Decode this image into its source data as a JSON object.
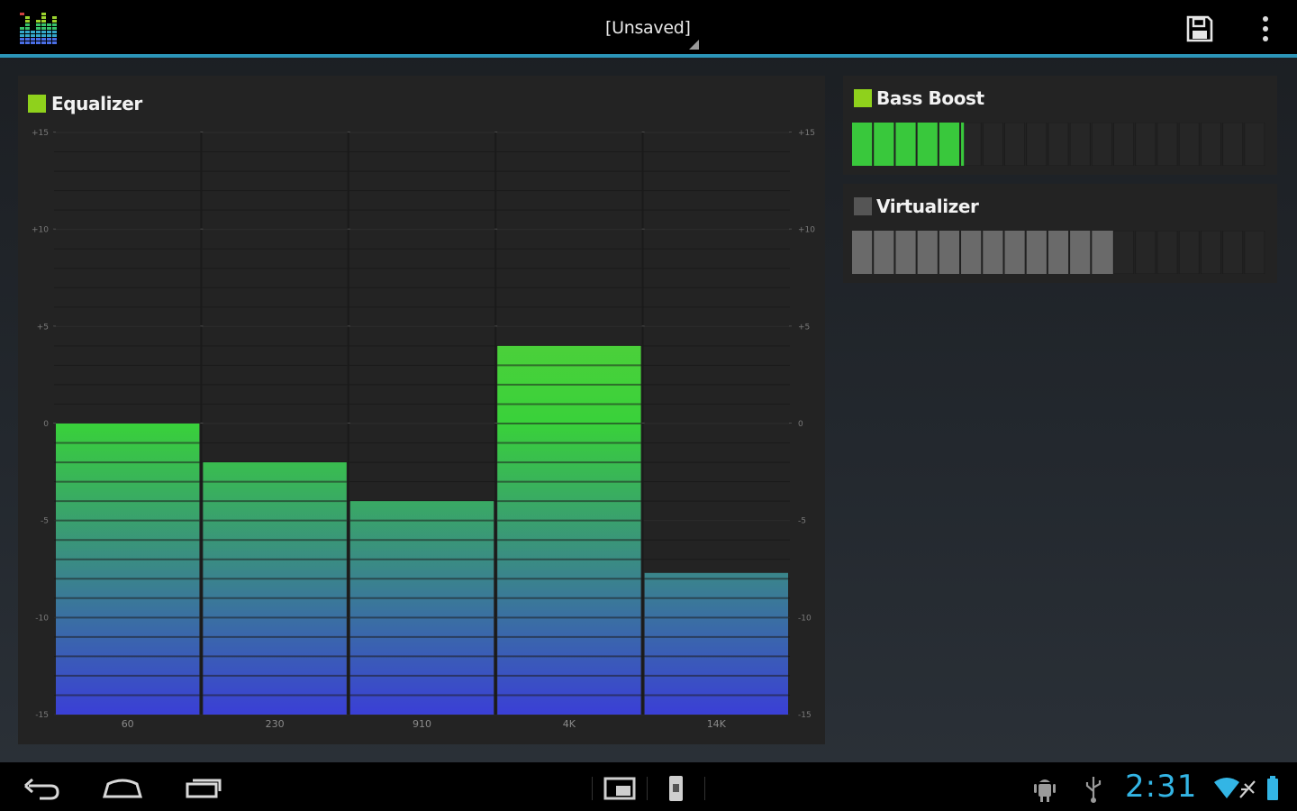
{
  "action_bar": {
    "title": "[Unsaved]",
    "app_icon": "equalizer-app-icon",
    "save_icon": "save-icon",
    "overflow_icon": "overflow-menu-icon",
    "accent_color": "#2c95b8"
  },
  "equalizer": {
    "label": "Equalizer",
    "enabled": true,
    "check_color": "#8fd11c",
    "chart_data": {
      "type": "bar",
      "categories": [
        "60",
        "230",
        "910",
        "4K",
        "14K"
      ],
      "values": [
        0,
        -2,
        -4,
        4,
        -7.7
      ],
      "ylim": [
        -15,
        15
      ],
      "y_ticks_left": [
        "+15",
        "+10",
        "+5",
        "0",
        "-5",
        "-10",
        "-15"
      ],
      "y_ticks_right": [
        "+15",
        "+10",
        "+5",
        "0",
        "-5",
        "-10",
        "-15"
      ],
      "grid": true,
      "gradient": [
        "#39d13a",
        "#3a3fd6"
      ]
    }
  },
  "bass_boost": {
    "label": "Bass Boost",
    "enabled": true,
    "check_color": "#8fd11c",
    "level": 0.27,
    "fill_color": "#39c83c"
  },
  "virtualizer": {
    "label": "Virtualizer",
    "enabled": false,
    "check_color": "#555555",
    "level": 0.63,
    "fill_color": "#6a6a6a"
  },
  "nav_bar": {
    "back_icon": "back-icon",
    "home_icon": "home-icon",
    "recents_icon": "recent-apps-icon",
    "screenshot_icon": "screenshot-icon",
    "notification_icon": "usb-storage-icon"
  },
  "status_bar": {
    "time": "2:31",
    "android_icon": "android-debug-icon",
    "usb_icon": "usb-icon",
    "wifi_icon": "wifi-icon",
    "airplane_icon": "airplane-icon",
    "battery_icon": "battery-icon"
  }
}
